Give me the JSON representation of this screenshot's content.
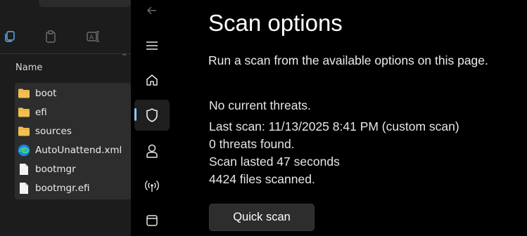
{
  "explorer": {
    "column_header": "Name",
    "files": [
      {
        "name": "boot",
        "icon": "folder-icon"
      },
      {
        "name": "efi",
        "icon": "folder-icon"
      },
      {
        "name": "sources",
        "icon": "folder-icon"
      },
      {
        "name": "AutoUnattend.xml",
        "icon": "edge-icon"
      },
      {
        "name": "bootmgr",
        "icon": "file-icon"
      },
      {
        "name": "bootmgr.efi",
        "icon": "file-icon"
      }
    ],
    "toolbar_icons": [
      "copy-icon",
      "paste-icon",
      "rename-icon"
    ]
  },
  "nav": {
    "items": [
      "back-icon",
      "menu-icon",
      "home-icon",
      "shield-icon",
      "account-icon",
      "network-icon",
      "app-browser-icon"
    ],
    "active": "shield-icon"
  },
  "main": {
    "title": "Scan options",
    "description": "Run a scan from the available options on this page.",
    "status": {
      "threats": "No current threats.",
      "last_scan": "Last scan: 11/13/2025 8:41 PM (custom scan)",
      "threats_found": "0 threats found.",
      "duration": "Scan lasted 47 seconds",
      "files_scanned": "4424 files scanned."
    },
    "quick_scan_label": "Quick scan"
  },
  "colors": {
    "accent": "#8ec8ff",
    "folder": "#f3c04f",
    "background": "#000000",
    "explorer_bg": "#1c1c1c"
  }
}
